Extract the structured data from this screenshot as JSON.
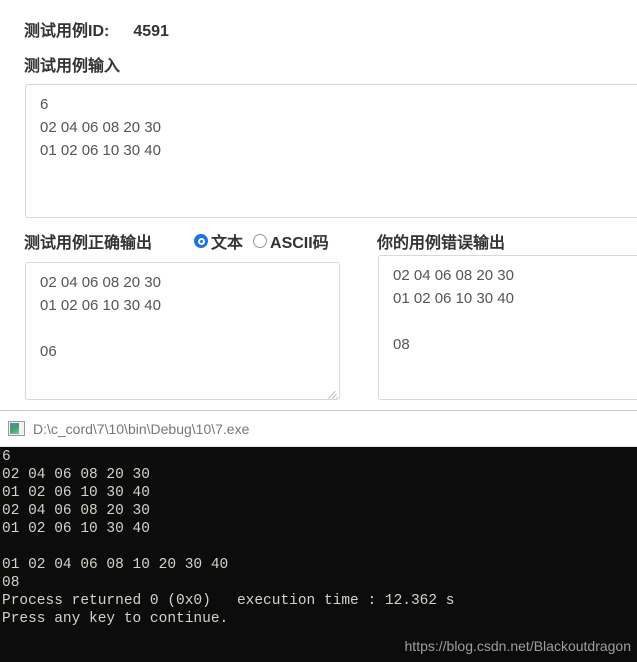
{
  "form": {
    "case_id_label": "测试用例ID:",
    "case_id_value": "4591",
    "input_label": "测试用例输入",
    "input_value": "6\n02 04 06 08 20 30\n01 02 06 10 30 40",
    "input_placeholder": "",
    "correct_output_label": "测试用例正确输出",
    "correct_output_value": "02 04 06 08 20 30\n01 02 06 10 30 40\n\n06",
    "correct_output_placeholder": "",
    "wrong_output_label": "你的用例错误输出",
    "wrong_output_value": "02 04 06 08 20 30\n01 02 06 10 30 40\n\n08",
    "wrong_output_placeholder": "",
    "format_options": [
      {
        "label": "文本",
        "selected": true
      },
      {
        "label": "ASCII码",
        "selected": false
      }
    ]
  },
  "console": {
    "title": "D:\\c_cord\\7\\10\\bin\\Debug\\10\\7.exe",
    "icon": "console-window-icon",
    "output": "6\n02 04 06 08 20 30\n01 02 06 10 30 40\n02 04 06 08 20 30\n01 02 06 10 30 40\n\n01 02 04 06 08 10 20 30 40\n08\nProcess returned 0 (0x0)   execution time : 12.362 s\nPress any key to continue.",
    "watermark": "https://blog.csdn.net/Blackoutdragon"
  },
  "colors": {
    "accent": "#1a73e8",
    "console_bg": "#0c0c0c",
    "console_fg": "#d6d2c8",
    "border": "#d8d8d8"
  }
}
